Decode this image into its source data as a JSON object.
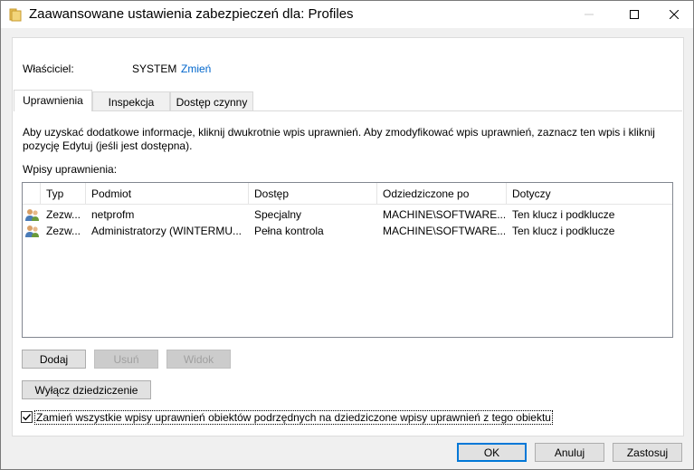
{
  "window": {
    "title": "Zaawansowane ustawienia zabezpieczeń dla: Profiles"
  },
  "owner": {
    "label": "Właściciel:",
    "value": "SYSTEM",
    "change_link": "Zmień"
  },
  "tabs": [
    {
      "label": "Uprawnienia",
      "active": true
    },
    {
      "label": "Inspekcja",
      "active": false
    },
    {
      "label": "Dostęp czynny",
      "active": false
    }
  ],
  "info_text": "Aby uzyskać dodatkowe informacje, kliknij dwukrotnie wpis uprawnień. Aby zmodyfikować wpis uprawnień, zaznacz ten wpis i kliknij pozycję Edytuj (jeśli jest dostępna).",
  "entries_label": "Wpisy uprawnienia:",
  "table": {
    "columns": [
      "Typ",
      "Podmiot",
      "Dostęp",
      "Odziedziczone po",
      "Dotyczy"
    ],
    "rows": [
      [
        "Zezw...",
        "netprofm",
        "Specjalny",
        "MACHINE\\SOFTWARE...",
        "Ten klucz i podklucze"
      ],
      [
        "Zezw...",
        "Administratorzy (WINTERMU...",
        "Pełna kontrola",
        "MACHINE\\SOFTWARE...",
        "Ten klucz i podklucze"
      ]
    ]
  },
  "buttons": {
    "add": "Dodaj",
    "remove": "Usuń",
    "view": "Widok",
    "disable_inheritance": "Wyłącz dziedziczenie",
    "ok": "OK",
    "cancel": "Anuluj",
    "apply": "Zastosuj"
  },
  "replace_checkbox": {
    "label": "Zamień wszystkie wpisy uprawnień obiektów podrzędnych na dziedziczone wpisy uprawnień z tego obiektu",
    "checked": true
  },
  "colors": {
    "link": "#0066cc",
    "default_button_border": "#0078d7"
  }
}
